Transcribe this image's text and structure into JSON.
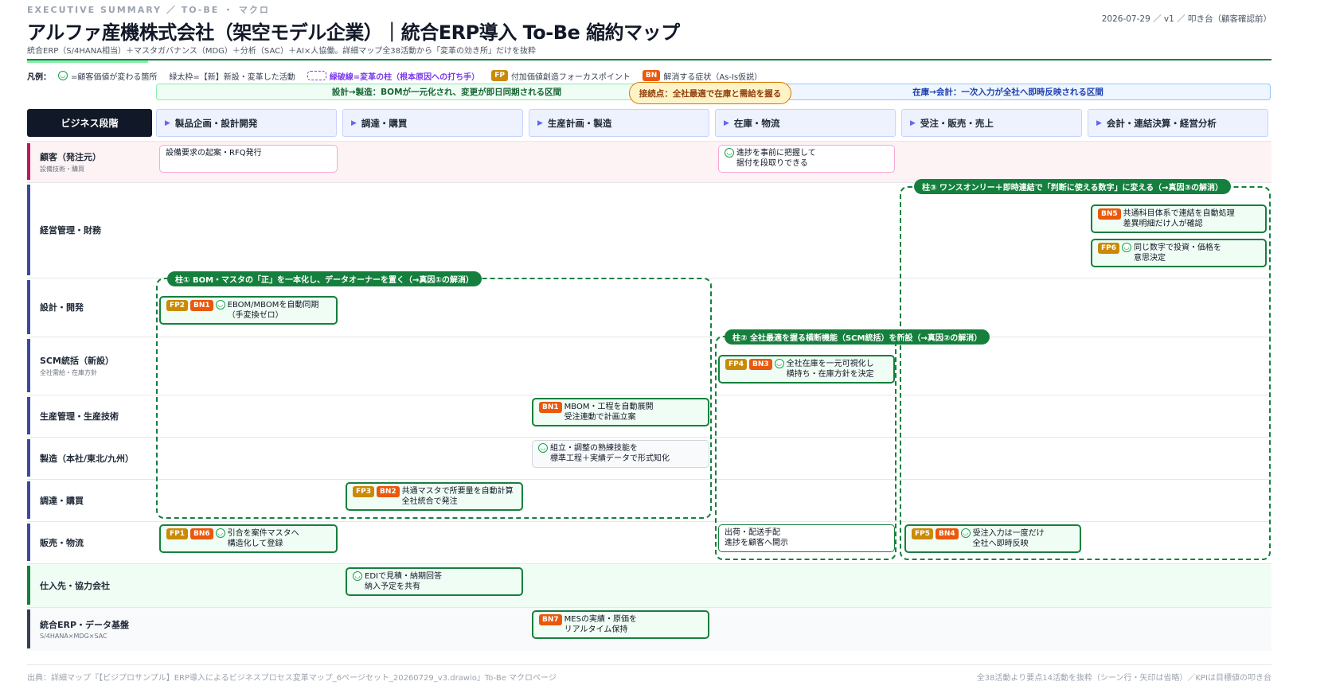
{
  "header": {
    "eyebrow": "EXECUTIVE SUMMARY ／ TO-BE ・ マクロ",
    "title": "アルファ産機株式会社（架空モデル企業）｜統合ERP導入 To-Be 縮約マップ",
    "subtitle": "統合ERP（S/4HANA相当）＋マスタガバナンス（MDG）＋分析（SAC）＋AI×人協働。詳細マップ全38活動から「変革の効き所」だけを抜粋",
    "meta": "2026-07-29 ／ v1 ／ 叩き台（顧客確認前）"
  },
  "legend": {
    "lead": "凡例：",
    "smile_text": "=顧客価値が変わる箇所",
    "bold_text": "緑太枠=【新】新設・変革した活動",
    "pillar_text": "緑破線=変革の柱（根本原因への打ち手）",
    "fp_tag": "FP",
    "fp_text": "付加価値創造フォーカスポイント",
    "bn_tag": "BN",
    "bn_text": "解消する症状（As-Is仮説）"
  },
  "zones": {
    "left": "設計→製造：BOMが一元化され、変更が即日同期される区間",
    "junction": "接続点：全社最適で在庫と需給を握る",
    "right": "在庫→会計：一次入力が全社へ即時反映される区間"
  },
  "stage_header": "ビジネス段階",
  "columns": [
    {
      "label": "製品企画・設計開発"
    },
    {
      "label": "調達・購買"
    },
    {
      "label": "生産計画・製造"
    },
    {
      "label": "在庫・物流"
    },
    {
      "label": "受注・販売・売上"
    },
    {
      "label": "会計・連結決算・経営分析"
    }
  ],
  "lanes": [
    {
      "name": "顧客（発注元）",
      "sub": "設備技術・購買"
    },
    {
      "name": "経営管理・財務",
      "sub": ""
    },
    {
      "name": "設計・開発",
      "sub": ""
    },
    {
      "name": "SCM統括（新設）",
      "sub": "全社需給・在庫方針"
    },
    {
      "name": "生産管理・生産技術",
      "sub": ""
    },
    {
      "name": "製造（本社/東北/九州）",
      "sub": ""
    },
    {
      "name": "調達・購買",
      "sub": ""
    },
    {
      "name": "販売・物流",
      "sub": ""
    },
    {
      "name": "仕入先・協力会社",
      "sub": ""
    },
    {
      "name": "統合ERP・データ基盤",
      "sub": "S/4HANA×MDG×SAC"
    }
  ],
  "pillars": [
    {
      "label": "柱① BOM・マスタの「正」を一本化し、データオーナーを置く（→真因①の解消）"
    },
    {
      "label": "柱② 全社最適を握る横断機能（SCM統括）を新設（→真因②の解消）"
    },
    {
      "label": "柱③ ワンスオンリー＋即時連結で「判断に使える数字」に変える（→真因③の解消）"
    }
  ],
  "activities": [
    {
      "text": "設備要求の起案・RFQ発行"
    },
    {
      "text": "進捗を事前に把握して\n据付を段取りできる"
    },
    {
      "tags": [
        "BN5"
      ],
      "text": "共通科目体系で連結を自動処理\n差異明細だけ人が確認"
    },
    {
      "tags": [
        "FP6"
      ],
      "text": "同じ数字で投資・価格を\n意思決定"
    },
    {
      "tags": [
        "FP2",
        "BN1"
      ],
      "text": "EBOM/MBOMを自動同期\n（手変換ゼロ）"
    },
    {
      "tags": [
        "FP4",
        "BN3"
      ],
      "text": "全社在庫を一元可視化し\n横持ち・在庫方針を決定"
    },
    {
      "tags": [
        "BN1"
      ],
      "text": "MBOM・工程を自動展開\n受注連動で計画立案"
    },
    {
      "text": "組立・調整の熟練技能を\n標準工程＋実績データで形式知化"
    },
    {
      "tags": [
        "FP3",
        "BN2"
      ],
      "text": "共通マスタで所要量を自動計算\n全社統合で発注"
    },
    {
      "tags": [
        "FP1",
        "BN6"
      ],
      "text": "引合を案件マスタへ\n構造化して登録"
    },
    {
      "text": "出荷・配送手配\n進捗を顧客へ開示"
    },
    {
      "tags": [
        "FP5",
        "BN4"
      ],
      "text": "受注入力は一度だけ\n全社へ即時反映"
    },
    {
      "text": "EDIで見積・納期回答\n納入予定を共有"
    },
    {
      "tags": [
        "BN7"
      ],
      "text": "MESの実績・原価を\nリアルタイム保持"
    }
  ],
  "footer": {
    "left": "出典：詳細マップ『【ビジプロサンプル】ERP導入によるビジネスプロセス変革マップ_6ページセット_20260729_v3.drawio』To-Be マクロページ",
    "right": "全38活動より要点14活動を抜粋（シーン行・矢印は省略）／KPIは目標値の叩き台"
  },
  "colors": {
    "brand_green": "#15803d",
    "lane_accent": "#3b4a9b",
    "fp_tag": "#ca8a04",
    "bn_tag": "#ea580c",
    "junction": "#d97706",
    "stage_header_bg": "#111827"
  }
}
